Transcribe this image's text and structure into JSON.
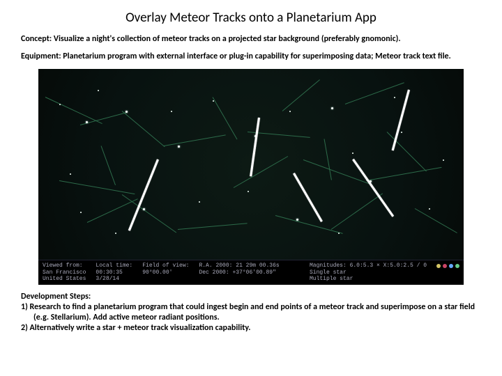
{
  "title": "Overlay Meteor Tracks onto a Planetarium App",
  "concept": {
    "label": "Concept:",
    "text": "Visualize a night's collection of meteor tracks on a projected star background (preferably gnomonic)."
  },
  "equipment": {
    "label": "Equipment:",
    "text": "Planetarium program with external interface or plug-in capability for superimposing data; Meteor track text file."
  },
  "infobar": {
    "c1a": "Viewed from:",
    "c1b": "San Francisco",
    "c1c": "United States",
    "c2a": "Local time:",
    "c2b": "00:30:35",
    "c2c": "3/28/14",
    "c3a": "Field of view:",
    "c3b": "90°00.00'",
    "c3c": "",
    "c4a": "R.A. 2000: 21 29m 00.36s",
    "c4b": "Dec 2000: +37°06'00.89\"",
    "c5a": "Magnitudes: 6.0:5.3 × X:5.0:2.5  /  0",
    "c5b": "Single star",
    "c5c": "Multiple star"
  },
  "steps": {
    "head": "Development Steps:",
    "s1": "1)  Research to find a planetarium program that could ingest begin and end points of a meteor track and superimpose on a star field (e.g. Stellarium). Add active meteor radiant positions.",
    "s2": "2)  Alternatively write a star + meteor track visualization capability."
  }
}
